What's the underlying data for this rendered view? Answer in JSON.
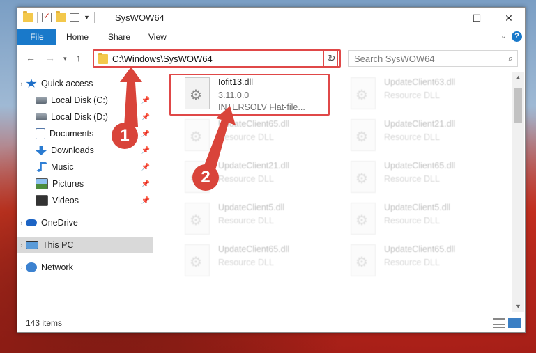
{
  "window": {
    "title": "SysWOW64",
    "controls": {
      "minimize": "—",
      "maximize": "☐",
      "close": "✕"
    }
  },
  "ribbon": {
    "tabs": [
      "File",
      "Home",
      "Share",
      "View"
    ],
    "help": "?"
  },
  "navigation": {
    "address": "C:\\Windows\\SysWOW64",
    "search_placeholder": "Search SysWOW64"
  },
  "sidebar": {
    "items": [
      {
        "label": "Quick access",
        "icon": "star-icon",
        "pinned": false
      },
      {
        "label": "Local Disk (C:)",
        "icon": "disk-icon",
        "pinned": true
      },
      {
        "label": "Local Disk (D:)",
        "icon": "disk-icon",
        "pinned": true
      },
      {
        "label": "Documents",
        "icon": "documents-icon",
        "pinned": true
      },
      {
        "label": "Downloads",
        "icon": "download-icon",
        "pinned": true
      },
      {
        "label": "Music",
        "icon": "music-icon",
        "pinned": true
      },
      {
        "label": "Pictures",
        "icon": "pictures-icon",
        "pinned": true
      },
      {
        "label": "Videos",
        "icon": "videos-icon",
        "pinned": true
      },
      {
        "label": "OneDrive",
        "icon": "cloud-icon",
        "pinned": false
      },
      {
        "label": "This PC",
        "icon": "computer-icon",
        "pinned": false,
        "selected": true
      },
      {
        "label": "Network",
        "icon": "network-icon",
        "pinned": false
      }
    ]
  },
  "files": [
    {
      "name": "Iofit13.dll",
      "version": "3.11.0.0",
      "description": "INTERSOLV Flat-file...",
      "highlighted": true
    },
    {
      "name": "UpdateClient63.dll",
      "description": "Resource DLL"
    },
    {
      "name": "UpdateClient65.dll",
      "description": "Resource DLL"
    },
    {
      "name": "UpdateClient21.dll",
      "description": "Resource DLL"
    },
    {
      "name": "UpdateClient21.dll",
      "description": "Resource DLL"
    },
    {
      "name": "UpdateClient65.dll",
      "description": "Resource DLL"
    },
    {
      "name": "UpdateClient5.dll",
      "description": "Resource DLL"
    },
    {
      "name": "UpdateClient5.dll",
      "description": "Resource DLL"
    },
    {
      "name": "UpdateClient65.dll",
      "description": "Resource DLL"
    },
    {
      "name": "UpdateClient65.dll",
      "description": "Resource DLL"
    }
  ],
  "status": {
    "item_count": "143 items"
  },
  "callouts": [
    "1",
    "2"
  ],
  "colors": {
    "accent": "#1979ca",
    "highlight": "#e04848",
    "callout": "#d9443a"
  }
}
